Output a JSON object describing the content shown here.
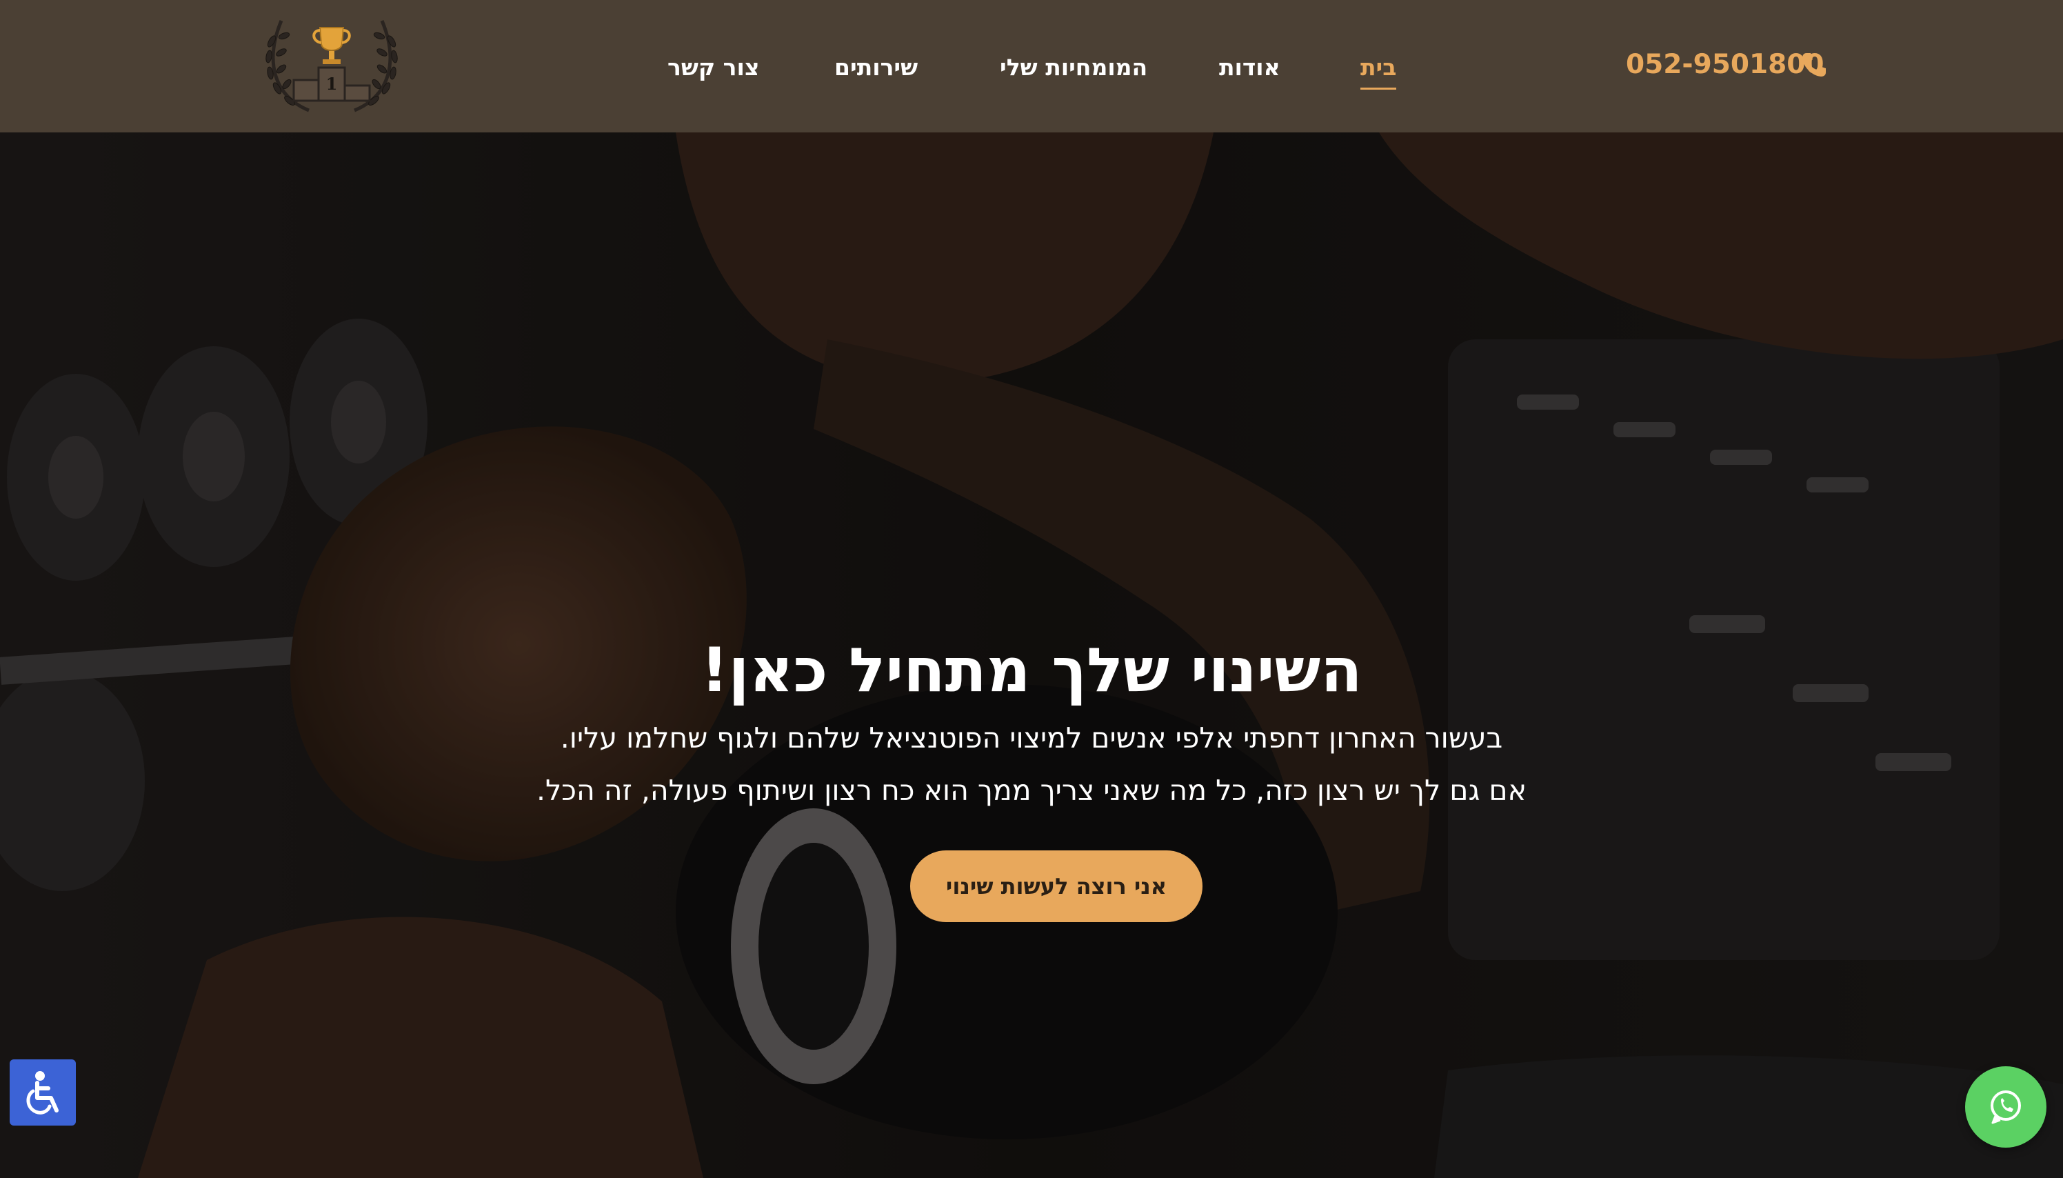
{
  "header": {
    "phone": "052-9501800",
    "nav": [
      {
        "label": "בית",
        "active": true
      },
      {
        "label": "אודות",
        "active": false
      },
      {
        "label": "המומחיות שלי",
        "active": false
      },
      {
        "label": "שירותים",
        "active": false
      },
      {
        "label": "צור קשר",
        "active": false
      }
    ],
    "logo_icon": "trophy-laurel-logo",
    "phone_icon": "phone-icon"
  },
  "hero": {
    "title": "השינוי שלך מתחיל כאן!",
    "line1": "בעשור האחרון דחפתי אלפי אנשים למיצוי הפוטנציאל שלהם ולגוף שחלמו עליו.",
    "line2": "אם גם לך יש רצון כזה, כל מה שאני צריך ממך הוא כח רצון ושיתוף פעולה, זה הכל.",
    "cta_label": "אני רוצה לעשות שינוי"
  },
  "floating": {
    "accessibility_icon": "accessibility-icon",
    "whatsapp_icon": "whatsapp-icon"
  },
  "colors": {
    "header_bg": "#4b4034",
    "accent": "#e8a85c",
    "whatsapp": "#5bd163",
    "accessibility": "#3c63d6"
  }
}
